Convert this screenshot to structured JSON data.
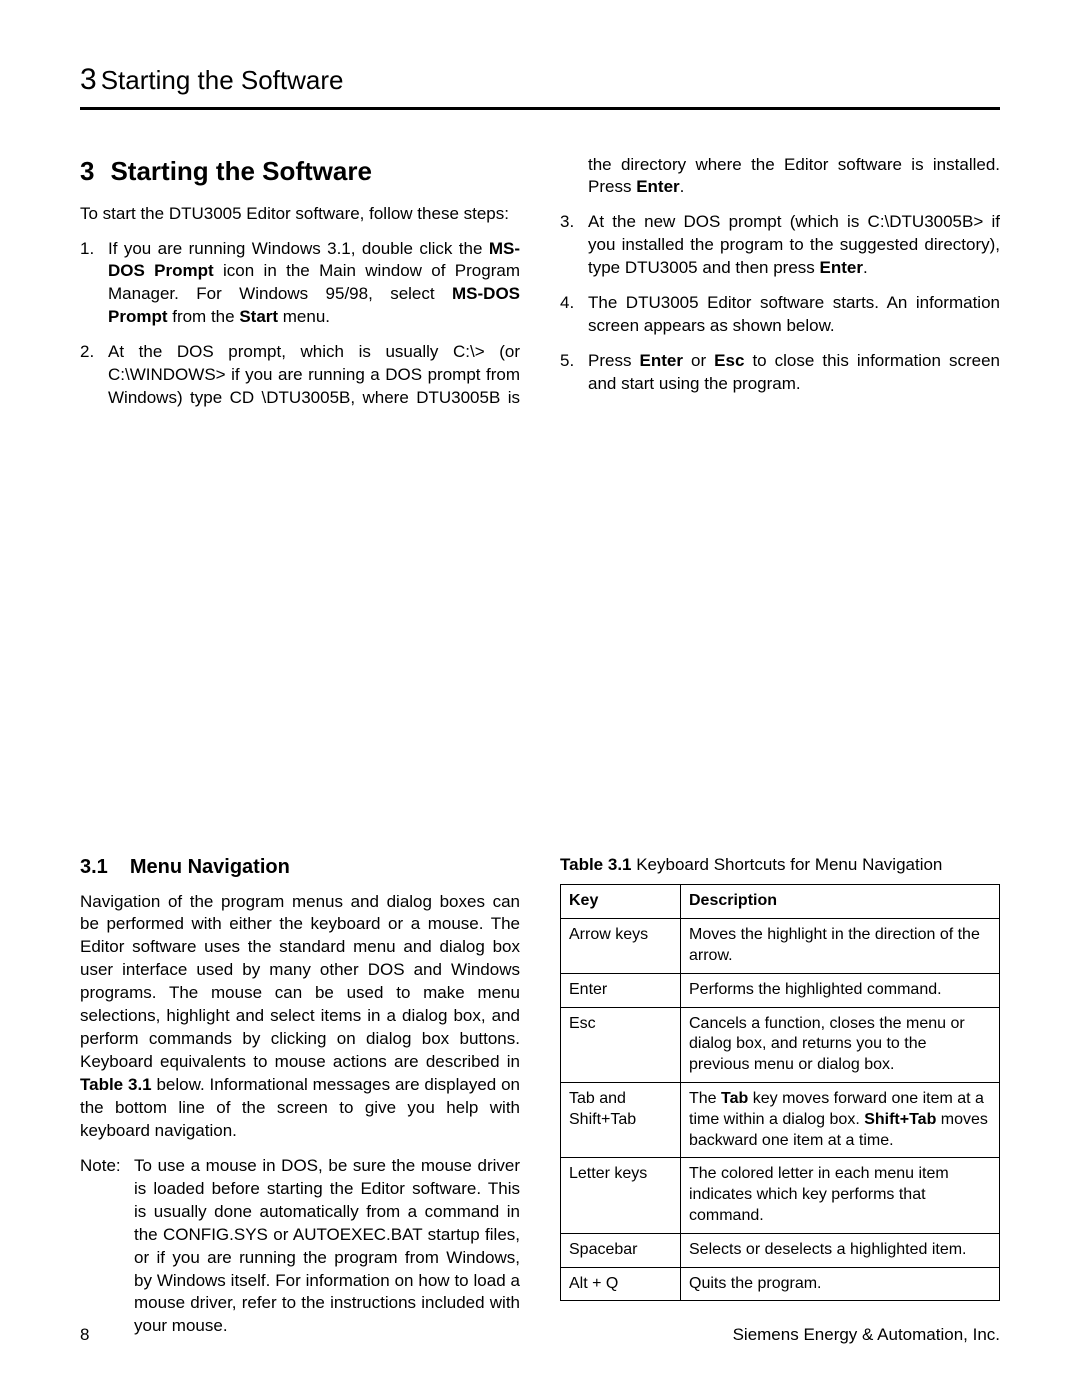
{
  "running_head": {
    "chapter_number": "3",
    "chapter_title": "Starting the Software"
  },
  "section": {
    "number": "3",
    "title": "Starting the Software",
    "intro": "To start the DTU3005 Editor software, follow these steps:",
    "steps": [
      {
        "n": "1.",
        "parts": [
          "If you are running Windows 3.1, double click the ",
          {
            "b": "MS-DOS Prompt"
          },
          " icon in the Main window of Program Manager. For Windows 95/98, select ",
          {
            "b": "MS-DOS Prompt"
          },
          " from the ",
          {
            "b": "Start"
          },
          " menu."
        ]
      },
      {
        "n": "2.",
        "parts": [
          "At the DOS prompt, which is usually C:\\>  (or C:\\WINDOWS> if you are running a DOS prompt from Windows) type CD \\DTU3005B, where DTU3005B is the directory where the Editor software is installed. Press ",
          {
            "b": "Enter"
          },
          "."
        ]
      },
      {
        "n": "3.",
        "parts": [
          "At the new DOS prompt (which is C:\\DTU3005B> if you installed the program to the suggested directory), type DTU3005 and then press ",
          {
            "b": "Enter"
          },
          "."
        ]
      },
      {
        "n": "4.",
        "parts": [
          "The DTU3005 Editor software starts. An information screen appears as shown below."
        ]
      },
      {
        "n": "5.",
        "parts": [
          "Press ",
          {
            "b": "Enter"
          },
          " or ",
          {
            "b": "Esc"
          },
          " to close this information screen and start using the program."
        ]
      }
    ]
  },
  "subsection": {
    "number": "3.1",
    "title": "Menu Navigation",
    "para_parts": [
      "Navigation of the program menus and dialog boxes can be performed with either the keyboard or a mouse. The Editor software uses the standard menu and dialog box user interface used by many other DOS and Windows programs. The mouse can be used to make menu selections, highlight and select items in a dialog box, and perform commands by clicking on dialog box buttons. Keyboard equivalents to mouse actions are described in ",
      {
        "b": "Table 3.1"
      },
      " below. Informational messages are displayed on the bottom line of the screen to give you help with keyboard navigation."
    ],
    "note_label": "Note:",
    "note_text": "To use a mouse in DOS, be sure the mouse driver is loaded before starting the Editor software. This is usually done automatically from a command in the CONFIG.SYS or AUTOEXEC.BAT startup files, or if you are running the program from Windows, by Windows itself. For information on how to load a mouse driver, refer to the instructions included with your mouse."
  },
  "table": {
    "caption_parts": [
      {
        "b": "Table 3.1"
      },
      " Keyboard Shortcuts for Menu Navigation"
    ],
    "head": {
      "key": "Key",
      "desc": "Description"
    },
    "rows": [
      {
        "key": "Arrow keys",
        "desc_parts": [
          "Moves the highlight in the direction of the arrow."
        ]
      },
      {
        "key": "Enter",
        "desc_parts": [
          "Performs the highlighted command."
        ]
      },
      {
        "key": "Esc",
        "desc_parts": [
          "Cancels a function, closes the menu or dialog box, and returns you to the previous menu or dialog box."
        ]
      },
      {
        "key": "Tab and Shift+Tab",
        "desc_parts": [
          "The ",
          {
            "b": "Tab"
          },
          " key moves forward one item at a time within a dialog box. ",
          {
            "b": "Shift+Tab"
          },
          " moves backward one item at a time."
        ]
      },
      {
        "key": "Letter keys",
        "desc_parts": [
          "The colored letter in each menu item indicates which key performs that command."
        ]
      },
      {
        "key": "Spacebar",
        "desc_parts": [
          "Selects or deselects a highlighted item."
        ]
      },
      {
        "key": "Alt + Q",
        "desc_parts": [
          "Quits the program."
        ]
      }
    ]
  },
  "footer": {
    "page": "8",
    "org": "Siemens Energy & Automation, Inc."
  }
}
